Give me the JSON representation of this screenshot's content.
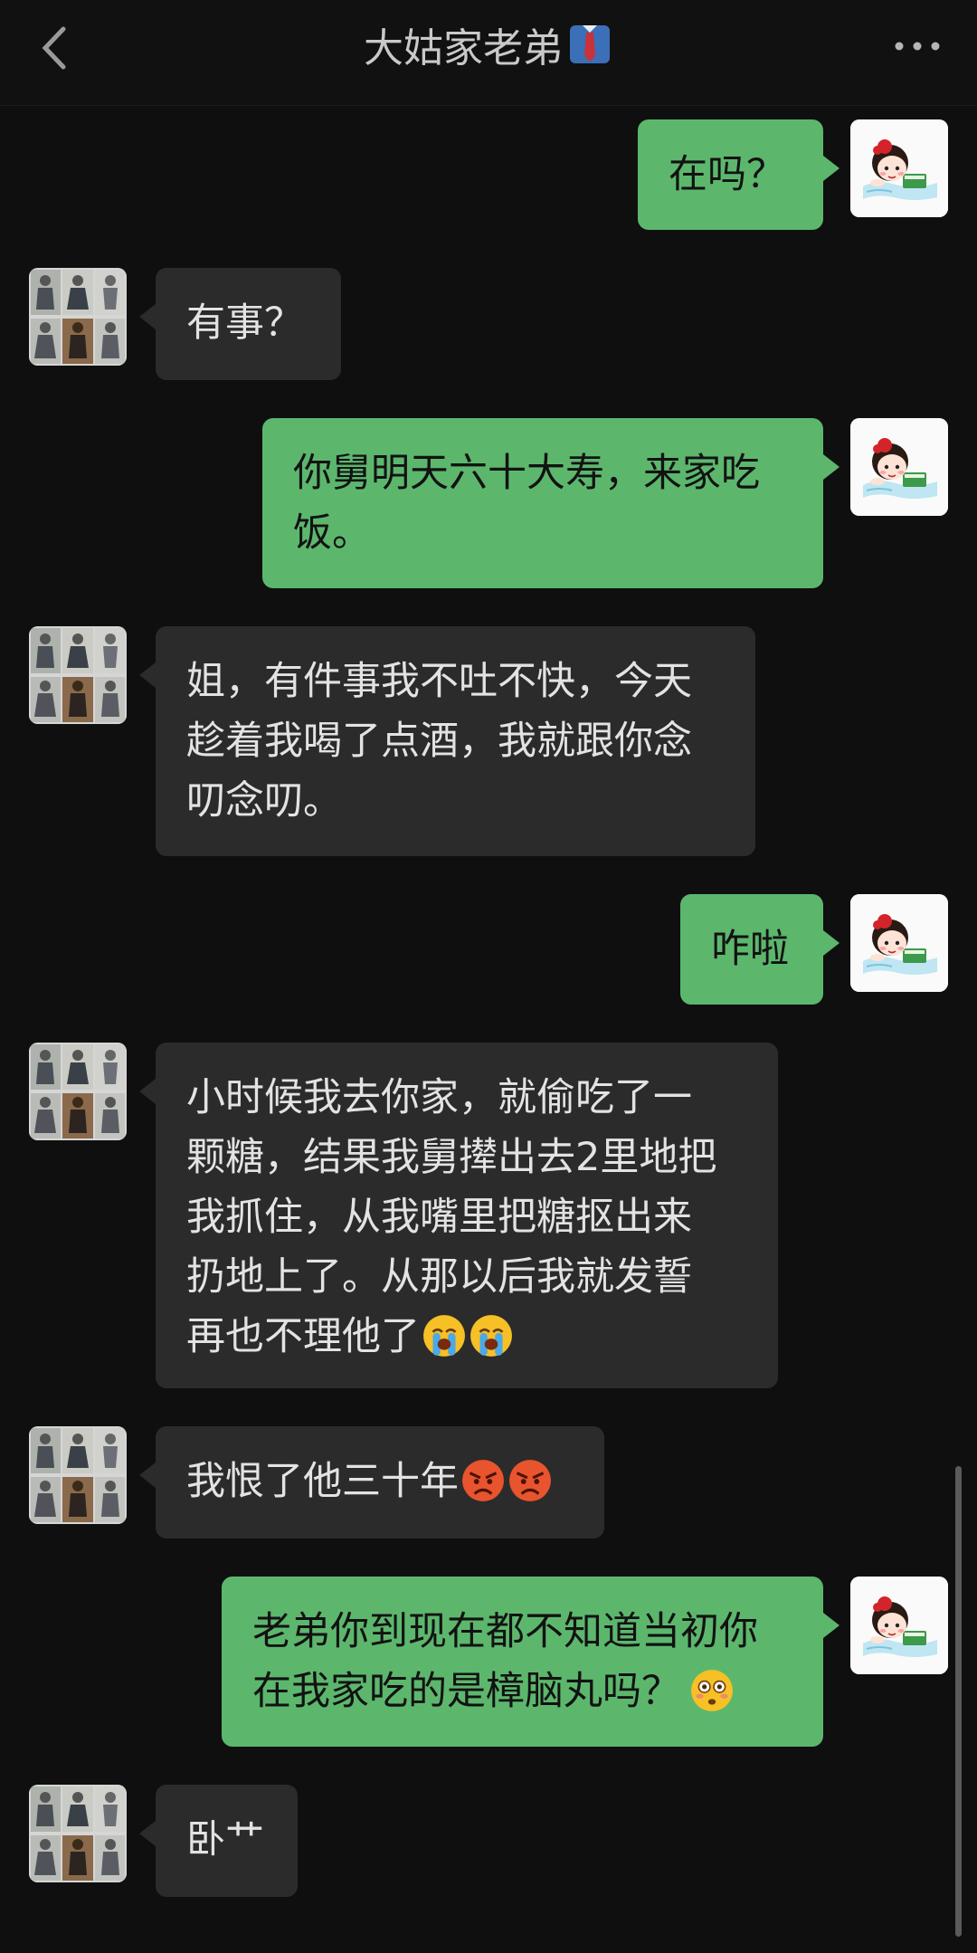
{
  "header": {
    "title": "大姑家老弟",
    "title_icon": "tie-shirt-emoji",
    "back_icon": "chevron-left-icon",
    "more_icon": "more-dots-icon"
  },
  "messages": [
    {
      "sender": "me",
      "text": "在吗？"
    },
    {
      "sender": "other",
      "text": "有事？"
    },
    {
      "sender": "me",
      "line1": "你舅明天六十大寿，来家吃",
      "line2": "饭。"
    },
    {
      "sender": "other",
      "line1": "姐，有件事我不吐不快，今天",
      "line2": "趁着我喝了点酒，我就跟你念",
      "line3": "叨念叨。"
    },
    {
      "sender": "me",
      "text": "咋啦"
    },
    {
      "sender": "other",
      "line1": "小时候我去你家，就偷吃了一",
      "line2": "颗糖，结果我舅撵出去2里地把",
      "line3": "我抓住，从我嘴里把糖抠出来",
      "line4": "扔地上了。从那以后我就发誓",
      "line5": "再也不理他了",
      "emoji": "crying-face-emoji"
    },
    {
      "sender": "other",
      "text": "我恨了他三十年",
      "emoji": "angry-face-emoji"
    },
    {
      "sender": "me",
      "line1": "老弟你到现在都不知道当初你",
      "line2": "在我家吃的是樟脑丸吗？",
      "emoji": "flushed-face-emoji"
    },
    {
      "sender": "other",
      "text": "卧艹"
    }
  ],
  "colors": {
    "background": "#0f0f0f",
    "my_bubble": "#5cb76d",
    "other_bubble": "#2b2b2b"
  }
}
